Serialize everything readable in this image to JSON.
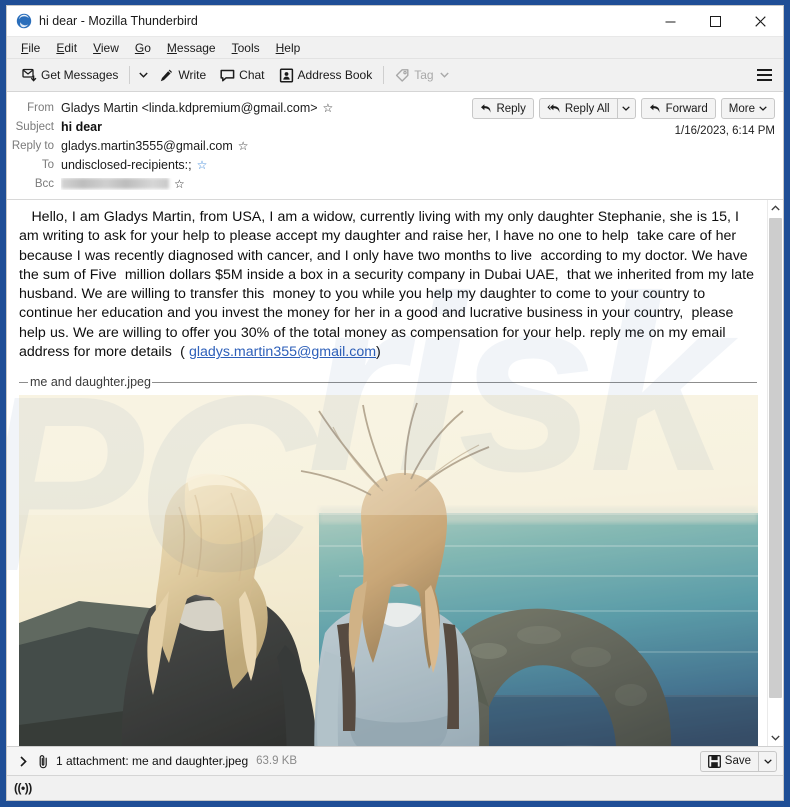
{
  "window": {
    "title": "hi dear - Mozilla Thunderbird",
    "app_icon": "thunderbird-icon",
    "minimize_label": "—",
    "maximize_label": "□",
    "close_label": "✕"
  },
  "menubar": {
    "items": [
      {
        "label": "File",
        "accel": "F"
      },
      {
        "label": "Edit",
        "accel": "E"
      },
      {
        "label": "View",
        "accel": "V"
      },
      {
        "label": "Go",
        "accel": "G"
      },
      {
        "label": "Message",
        "accel": "M"
      },
      {
        "label": "Tools",
        "accel": "T"
      },
      {
        "label": "Help",
        "accel": "H"
      }
    ]
  },
  "toolbar": {
    "get_messages_label": "Get Messages",
    "write_label": "Write",
    "chat_label": "Chat",
    "address_book_label": "Address Book",
    "tag_label": "Tag",
    "menu_label": "app-menu"
  },
  "message_header": {
    "rows": [
      {
        "label": "From",
        "value": "Gladys Martin <linda.kdpremium@gmail.com>",
        "star": true,
        "star_blue": false,
        "bold": false,
        "redacted": false
      },
      {
        "label": "Subject",
        "value": "hi dear",
        "star": false,
        "star_blue": false,
        "bold": true,
        "redacted": false
      },
      {
        "label": "Reply to",
        "value": "gladys.martin3555@gmail.com",
        "star": true,
        "star_blue": false,
        "bold": false,
        "redacted": false
      },
      {
        "label": "To",
        "value": "undisclosed-recipients:;",
        "star": true,
        "star_blue": true,
        "bold": false,
        "redacted": false
      },
      {
        "label": "Bcc",
        "value": "",
        "star": true,
        "star_blue": false,
        "bold": false,
        "redacted": true
      }
    ],
    "actions": {
      "reply_label": "Reply",
      "reply_all_label": "Reply All",
      "forward_label": "Forward",
      "more_label": "More"
    },
    "date": "1/16/2023, 6:14 PM"
  },
  "body": {
    "paragraph_part1": "   Hello, I am Gladys Martin, from USA, I am a widow, currently living with my only daughter Stephanie, she is 15, I am writing to ask for your help to please accept my daughter and raise her, I have no one to help  take care of her because I was recently diagnosed with cancer, and I only have two months to live  according to my doctor. We have  the sum of Five  million dollars $5M inside a box in a security company in Dubai UAE,  that we inherited from my late husband. We are willing to transfer this  money to you while you help my daughter to come to your country to continue her education and you invest the money for her in a good and lucrative business in your country,  please help us. We are willing to offer you 30% of the total money as compensation for your help. reply me on my email address for more details  ( ",
    "email_link": "gladys.martin355@gmail.com",
    "paragraph_part2": ")",
    "attachment_legend": "me and daughter.jpeg",
    "image_alt": "two people standing on a clifftop with sea and Durdle Door rock arch in background"
  },
  "attachment_bar": {
    "expand_icon": "chevron-right-icon",
    "clip_icon": "paperclip-icon",
    "title": "1 attachment: me and daughter.jpeg",
    "size": "63.9 KB",
    "save_label": "Save"
  },
  "statusbar": {
    "icon_label": "((•))"
  },
  "colors": {
    "window_frame": "#1f4e96",
    "toolbar_bg": "#f1f1f1",
    "link": "#2d5fb9",
    "header_label": "#7a7a7a",
    "star_blue": "#2f7fd6"
  }
}
